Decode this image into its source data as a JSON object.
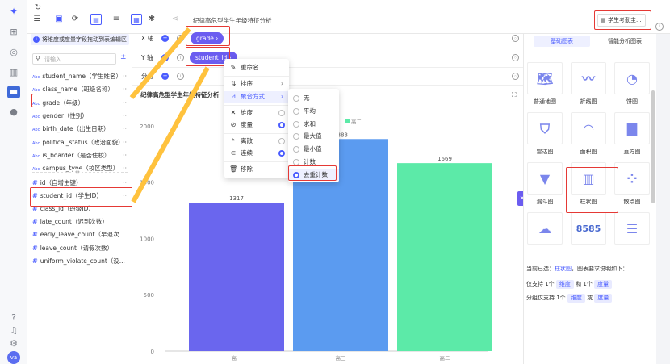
{
  "topbar": {
    "title": "纪律高危型学生年级特征分析",
    "datasource": "学生考勤主..."
  },
  "left": {
    "hint": "将维度或度量字段拖动到表编辑区",
    "search_placeholder": "请输入",
    "dimensions": [
      "student_name（学生姓名）",
      "class_name（班级名称）",
      "grade（年级）",
      "gender（性别）",
      "birth_date（出生日期）",
      "political_status（政治面貌）",
      "is_boarder（是否住校）",
      "campus_type（校区类型）"
    ],
    "measures": [
      "id（自增主键）",
      "student_id（学生ID）",
      "class_id（班级ID）",
      "late_count（迟到次数）",
      "early_leave_count（早退次...",
      "leave_count（请假次数）",
      "uniform_violate_count（没..."
    ]
  },
  "axes": {
    "x_label": "X 轴",
    "y_label": "Y 轴",
    "group_label": "分组",
    "x_pill": "grade",
    "y_pill": "student_id"
  },
  "chart_title": "纪律高危型学生年级特征分析",
  "legend_text": "高二",
  "context_menu": [
    "重命名",
    "排序",
    "聚合方式",
    "维度",
    "度量",
    "离散",
    "连续",
    "移除"
  ],
  "agg_menu": [
    "无",
    "平均",
    "求和",
    "最大值",
    "最小值",
    "计数",
    "去重计数"
  ],
  "chart_data": {
    "type": "bar",
    "categories": [
      "高一",
      "高三",
      "高二"
    ],
    "values": [
      1317,
      1883,
      1669
    ],
    "ylim": [
      0,
      2100
    ],
    "yticks": [
      0,
      500,
      1000,
      1500,
      2000
    ],
    "colors": [
      "#6a66ee",
      "#5b9bf0",
      "#5ceaa8"
    ]
  },
  "right": {
    "tabs": [
      "基础图表",
      "智能分析图表"
    ],
    "charts": [
      "普通地图",
      "折线图",
      "饼图",
      "雷达图",
      "面积图",
      "直方图",
      "漏斗图",
      "柱状图",
      "散点图",
      "",
      "",
      ""
    ],
    "kpi_text": "8585",
    "selected_line1": "当前已选：",
    "selected_name": "柱状图",
    "selected_line1b": "，图表要求说明如下：",
    "req1a": "仅支持 1个",
    "req1_tag1": "维度",
    "req1b": "和 1个",
    "req1_tag2": "度量",
    "req2a": "分组仅支持 1个",
    "req2_tag1": "维度",
    "req2b": "或",
    "req2_tag2": "度量"
  },
  "user_initials": "va"
}
